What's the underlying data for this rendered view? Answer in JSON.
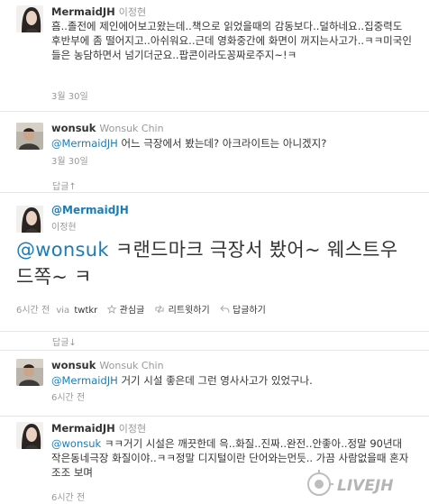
{
  "tweets": [
    {
      "screen_name": "MermaidJH",
      "full_name": "이정현",
      "text": "흠..졸전에 제인에어보고왔는데..책으로 읽었을때의 감동보다..덜하네요..집중력도 후반부에 좀 떨어지고..아쉬워요..근데 영화중간에 화면이 꺼지는사고가..ㅋㅋ미국인들은 농담하면서 넘기더군요..팝콘이라도꽁짜로주지~!ㅋ",
      "time": "3월 30일"
    },
    {
      "screen_name": "wonsuk",
      "full_name": "Wonsuk Chin",
      "mention": "@MermaidJH",
      "text": " 어느 극장에서 봤는데? 아크라이트는 아니겠지?",
      "time": "3월 30일"
    }
  ],
  "reply_up": "답글↑",
  "featured": {
    "screen_name": "@MermaidJH",
    "full_name": "이정현",
    "mention": "@wonsuk",
    "text": " ㅋ랜드마크 극장서 봤어~ 웨스트우드쪽~ ㅋ",
    "time": "6시간 전",
    "via": "via",
    "client": "twtkr",
    "favorite": "관심글",
    "retweet": "리트윗하기",
    "reply": "답글하기"
  },
  "reply_down": "답글↓",
  "replies": [
    {
      "screen_name": "wonsuk",
      "full_name": "Wonsuk Chin",
      "mention": "@MermaidJH",
      "text": " 거기 시설 좋은데 그런 영사사고가 있었구나.",
      "time": "6시간 전"
    },
    {
      "screen_name": "MermaidJH",
      "full_name": "이정현",
      "mention": "@wonsuk",
      "text": " ㅋㅋ거기 시설은 깨끗한데 윽..화질..진짜..완전..안좋아..정말 90년대 작은동네극장 화질이야..ㅋㅋ정말 디지털이란 단어와는먼듯.. 가끔 사람없을때 혼자 조조 보며",
      "time": "6시간 전"
    }
  ],
  "watermark": "LIVEJH",
  "colors": {
    "link": "#1b7cb6",
    "text": "#333333",
    "meta": "#999999",
    "divider": "#e6e6e6"
  }
}
